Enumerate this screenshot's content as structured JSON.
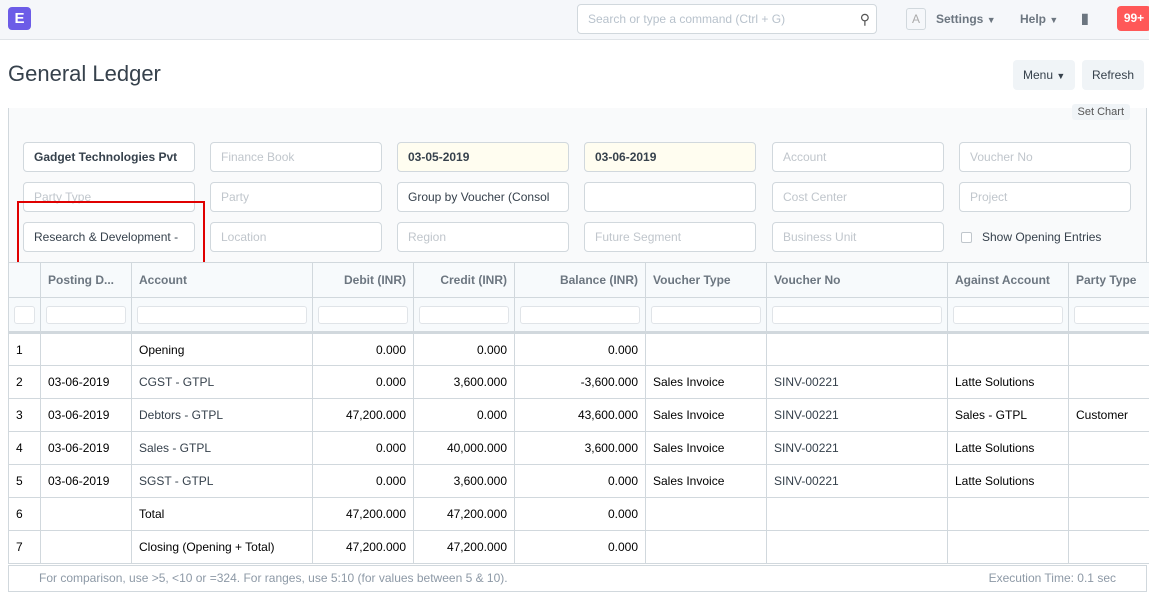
{
  "navbar": {
    "logo": "E",
    "search_placeholder": "Search or type a command (Ctrl + G)",
    "avatar": "A",
    "settings": "Settings",
    "help": "Help",
    "notifications": "99+"
  },
  "page": {
    "title": "General Ledger",
    "menu": "Menu",
    "refresh": "Refresh",
    "set_chart": "Set Chart"
  },
  "filters": {
    "company": "Gadget Technologies Pvt",
    "finance_book": "Finance Book",
    "from_date": "03-05-2019",
    "to_date": "03-06-2019",
    "account": "Account",
    "voucher_no": "Voucher No",
    "party_type": "Party Type",
    "party": "Party",
    "group_by": "Group by Voucher (Consol",
    "blank": "",
    "cost_center": "Cost Center",
    "project": "Project",
    "department": "Research & Development -",
    "location": "Location",
    "region": "Region",
    "future_segment": "Future Segment",
    "business_unit": "Business Unit",
    "show_opening": "Show Opening Entries"
  },
  "table": {
    "columns": [
      "Posting D...",
      "Account",
      "Debit (INR)",
      "Credit (INR)",
      "Balance (INR)",
      "Voucher Type",
      "Voucher No",
      "Against Account",
      "Party Type"
    ],
    "rows": [
      [
        "1",
        "",
        "Opening",
        "0.000",
        "0.000",
        "0.000",
        "",
        "",
        "",
        ""
      ],
      [
        "2",
        "03-06-2019",
        "CGST - GTPL",
        "0.000",
        "3,600.000",
        "-3,600.000",
        "Sales Invoice",
        "SINV-00221",
        "Latte Solutions",
        ""
      ],
      [
        "3",
        "03-06-2019",
        "Debtors - GTPL",
        "47,200.000",
        "0.000",
        "43,600.000",
        "Sales Invoice",
        "SINV-00221",
        "Sales - GTPL",
        "Customer"
      ],
      [
        "4",
        "03-06-2019",
        "Sales - GTPL",
        "0.000",
        "40,000.000",
        "3,600.000",
        "Sales Invoice",
        "SINV-00221",
        "Latte Solutions",
        ""
      ],
      [
        "5",
        "03-06-2019",
        "SGST - GTPL",
        "0.000",
        "3,600.000",
        "0.000",
        "Sales Invoice",
        "SINV-00221",
        "Latte Solutions",
        ""
      ],
      [
        "6",
        "",
        "Total",
        "47,200.000",
        "47,200.000",
        "0.000",
        "",
        "",
        "",
        ""
      ],
      [
        "7",
        "",
        "Closing (Opening + Total)",
        "47,200.000",
        "47,200.000",
        "0.000",
        "",
        "",
        "",
        ""
      ]
    ]
  },
  "footer": {
    "hint": "For comparison, use >5, <10 or =324. For ranges, use 5:10 (for values between 5 & 10).",
    "exec_time": "Execution Time: 0.1 sec"
  }
}
